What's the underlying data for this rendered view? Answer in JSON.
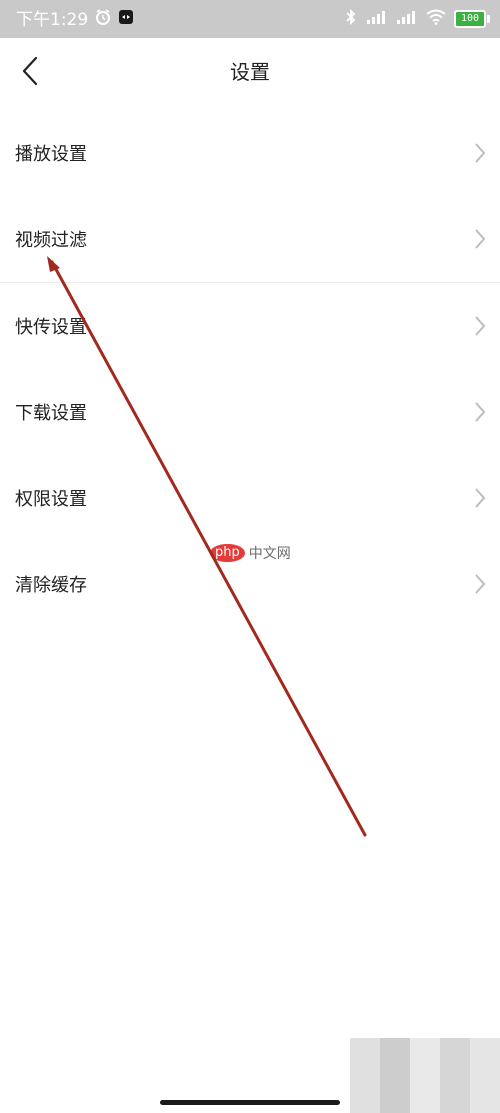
{
  "status_bar": {
    "time": "下午1:29",
    "battery": "100",
    "icons": [
      "alarm-icon",
      "app-notification-icon",
      "bluetooth-icon",
      "signal-icon",
      "signal-icon",
      "wifi-icon",
      "battery-icon"
    ]
  },
  "header": {
    "title": "设置",
    "back_icon": "back-arrow-icon"
  },
  "menu": {
    "items": [
      {
        "label": "播放设置"
      },
      {
        "label": "视频过滤"
      },
      {
        "label": "快传设置"
      },
      {
        "label": "下载设置"
      },
      {
        "label": "权限设置"
      },
      {
        "label": "清除缓存"
      }
    ]
  },
  "watermark": {
    "badge": "php",
    "text": "中文网"
  },
  "colors": {
    "status_bar_bg": "#c9c9c9",
    "text_primary": "#222222",
    "chevron": "#bdbdbd",
    "annotation_arrow": "#a3281e",
    "battery": "#3cb043"
  }
}
